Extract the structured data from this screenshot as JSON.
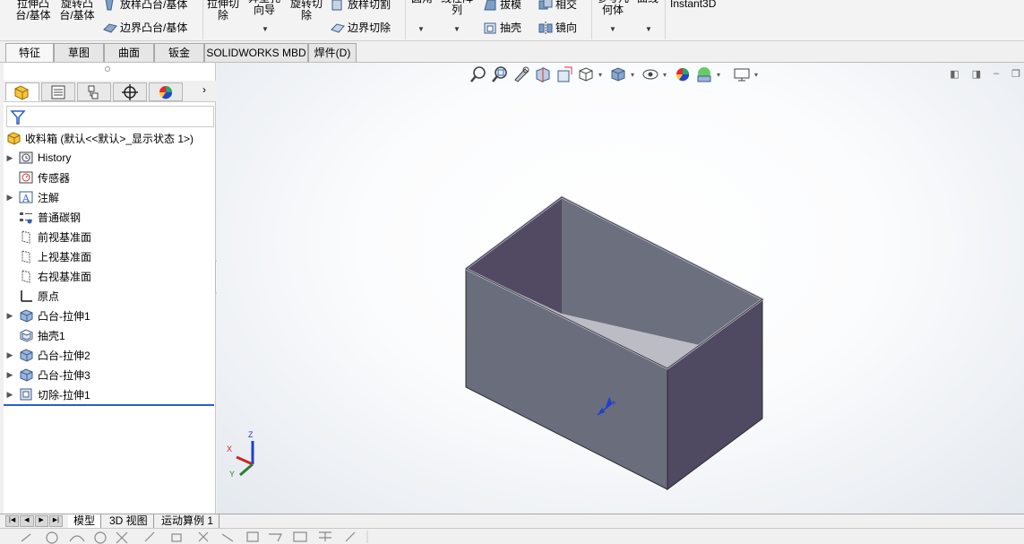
{
  "ribbon": {
    "extrude_boss": "拉伸凸\n台/基体",
    "revolve_boss": "旋转凸\n台/基体",
    "loft_boss": "放样凸台/基体",
    "boundary_boss": "边界凸台/基体",
    "extrude_cut": "拉伸切\n除",
    "hole_wizard": "异型孔\n向导",
    "revolve_cut": "旋转切\n除",
    "loft_cut": "放样切割",
    "boundary_cut": "边界切除",
    "fillet": "圆角",
    "linear_pattern": "线性阵\n列",
    "draft": "拔模",
    "shell": "抽壳",
    "intersect": "相交",
    "mirror": "镜向",
    "ref_geometry": "参考几\n何体",
    "curves": "曲线",
    "instant3d": "Instant3D"
  },
  "tabs": [
    "特征",
    "草图",
    "曲面",
    "钣金",
    "SOLIDWORKS MBD",
    "焊件(D)"
  ],
  "active_tab": "特征",
  "feature_tree": {
    "root": "收料箱  (默认<<默认>_显示状态 1>)",
    "items": [
      {
        "label": "History",
        "expandable": true,
        "icon": "history-icon"
      },
      {
        "label": "传感器",
        "expandable": false,
        "icon": "sensor-icon"
      },
      {
        "label": "注解",
        "expandable": true,
        "icon": "annotation-icon"
      },
      {
        "label": "普通碳钢",
        "expandable": false,
        "icon": "material-icon"
      },
      {
        "label": "前视基准面",
        "expandable": false,
        "icon": "plane-icon"
      },
      {
        "label": "上视基准面",
        "expandable": false,
        "icon": "plane-icon"
      },
      {
        "label": "右视基准面",
        "expandable": false,
        "icon": "plane-icon"
      },
      {
        "label": "原点",
        "expandable": false,
        "icon": "origin-icon"
      },
      {
        "label": "凸台-拉伸1",
        "expandable": true,
        "icon": "extrude-icon"
      },
      {
        "label": "抽壳1",
        "expandable": false,
        "icon": "shell-icon"
      },
      {
        "label": "凸台-拉伸2",
        "expandable": true,
        "icon": "extrude-icon"
      },
      {
        "label": "凸台-拉伸3",
        "expandable": true,
        "icon": "extrude-icon"
      },
      {
        "label": "切除-拉伸1",
        "expandable": true,
        "icon": "cut-extrude-icon"
      }
    ]
  },
  "triad": {
    "x": "X",
    "y": "Y",
    "z": "Z"
  },
  "bottom_tabs": [
    "模型",
    "3D 视图",
    "运动算例 1"
  ],
  "active_bottom_tab": "模型",
  "colors": {
    "model_side": "#6b6e7a",
    "model_dark": "#4f4961",
    "model_top": "#9a9cab",
    "accent": "#2a5fc8"
  }
}
